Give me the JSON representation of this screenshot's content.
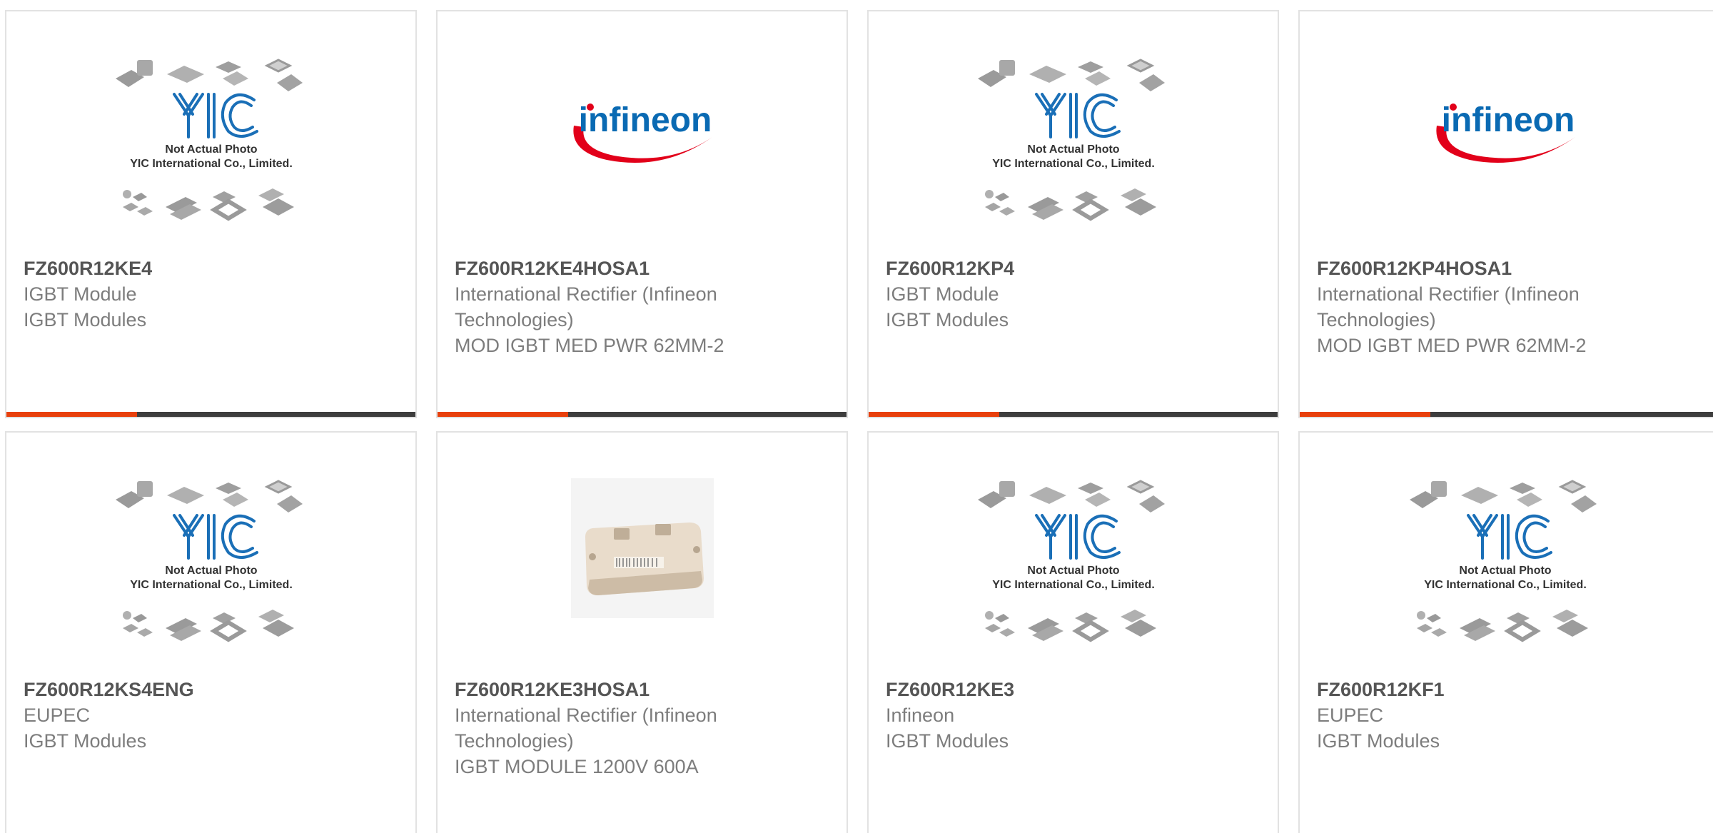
{
  "accent_color": "#e8400c",
  "bar_color": "#3d3d3d",
  "placeholder": {
    "line1": "Not Actual Photo",
    "line2": "YIC International Co., Limited.",
    "logo_text": "YIC"
  },
  "infineon_logo_text": "infineon",
  "products": [
    {
      "part": "FZ600R12KE4",
      "manufacturer": "IGBT Module",
      "description": "IGBT Modules",
      "image": "yic-placeholder"
    },
    {
      "part": "FZ600R12KE4HOSA1",
      "manufacturer": "International Rectifier (Infineon Technologies)",
      "description": "MOD IGBT MED PWR 62MM-2",
      "image": "infineon-logo"
    },
    {
      "part": "FZ600R12KP4",
      "manufacturer": "IGBT Module",
      "description": "IGBT Modules",
      "image": "yic-placeholder"
    },
    {
      "part": "FZ600R12KP4HOSA1",
      "manufacturer": "International Rectifier (Infineon Technologies)",
      "description": "MOD IGBT MED PWR 62MM-2",
      "image": "infineon-logo"
    },
    {
      "part": "FZ600R12KS4ENG",
      "manufacturer": "EUPEC",
      "description": "IGBT Modules",
      "image": "yic-placeholder"
    },
    {
      "part": "FZ600R12KE3HOSA1",
      "manufacturer": "International Rectifier (Infineon Technologies)",
      "description": "IGBT MODULE 1200V 600A",
      "image": "igbt-module-photo"
    },
    {
      "part": "FZ600R12KE3",
      "manufacturer": "Infineon",
      "description": "IGBT Modules",
      "image": "yic-placeholder"
    },
    {
      "part": "FZ600R12KF1",
      "manufacturer": "EUPEC",
      "description": "IGBT Modules",
      "image": "yic-placeholder"
    }
  ]
}
